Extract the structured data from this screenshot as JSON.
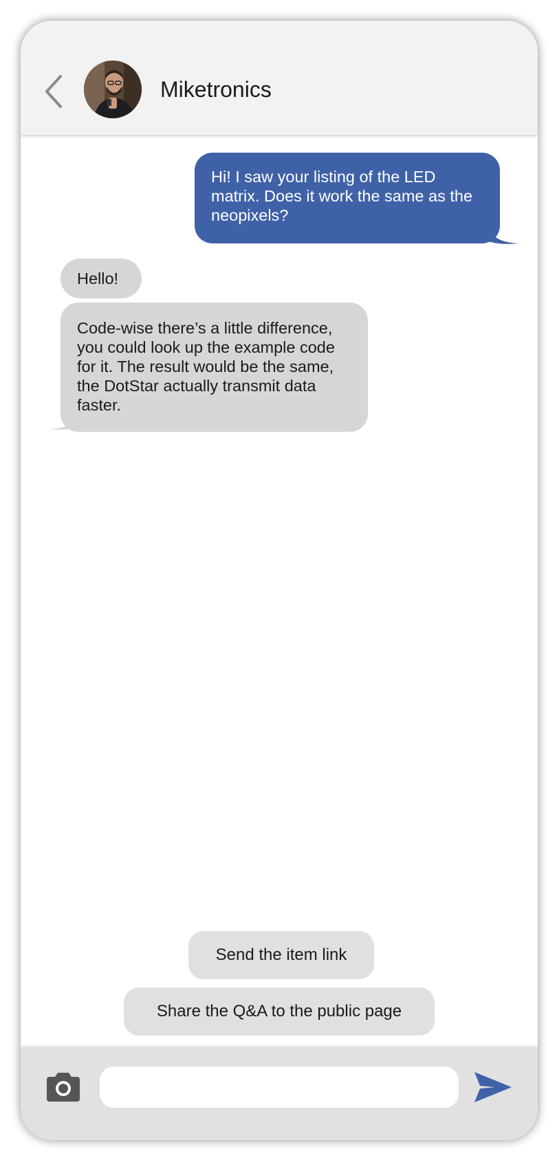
{
  "header": {
    "contact_name": "Miketronics",
    "back_icon": "chevron-left-icon",
    "avatar": "contact-avatar-photo"
  },
  "messages": [
    {
      "direction": "outgoing",
      "text": "Hi! I saw your listing of the LED matrix. Does it work the same as the neopixels?"
    },
    {
      "direction": "incoming",
      "text": "Hello!"
    },
    {
      "direction": "incoming",
      "text": "Code-wise there’s a little difference, you could look up the example code for it. The result would be the same, the DotStar actually transmit data faster."
    }
  ],
  "suggestions": [
    {
      "label": "Send the item link"
    },
    {
      "label": "Share the Q&A to the public page"
    }
  ],
  "composer": {
    "camera_icon": "camera-icon",
    "input_value": "",
    "send_icon": "send-icon"
  },
  "colors": {
    "outgoing_bubble": "#3f61a8",
    "incoming_bubble": "#d6d6d6",
    "suggestion_chip": "#e0e0e0",
    "header_bg": "#f2f2f2",
    "composer_bg": "#e1e1e1",
    "send_icon": "#3f61a8"
  }
}
